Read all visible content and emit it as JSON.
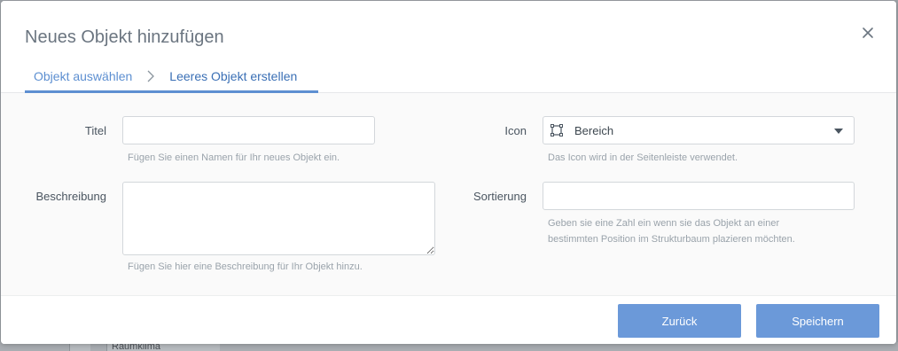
{
  "dialog": {
    "title": "Neues Objekt hinzufügen"
  },
  "breadcrumb": {
    "step1": "Objekt auswählen",
    "step2": "Leeres Objekt erstellen"
  },
  "form": {
    "title_label": "Titel",
    "title_value": "",
    "title_help": "Fügen Sie einen Namen für Ihr neues Objekt ein.",
    "description_label": "Beschreibung",
    "description_value": "",
    "description_help": "Fügen Sie hier eine Beschreibung für Ihr Objekt hinzu.",
    "icon_label": "Icon",
    "icon_value": "Bereich",
    "icon_help": "Das Icon wird in der Seitenleiste verwendet.",
    "sort_label": "Sortierung",
    "sort_value": "",
    "sort_help_line1": "Geben sie eine Zahl ein wenn sie das Objekt an einer",
    "sort_help_line2": "bestimmten Position im Strukturbaum plazieren möchten."
  },
  "footer": {
    "back_label": "Zurück",
    "save_label": "Speichern"
  },
  "background": {
    "partial_text": "Raumklima"
  },
  "colors": {
    "accent": "#5d8fd1",
    "button": "#6b99d9"
  },
  "icons": [
    "close-icon",
    "chevron-right-icon",
    "area-icon",
    "caret-down-icon"
  ]
}
